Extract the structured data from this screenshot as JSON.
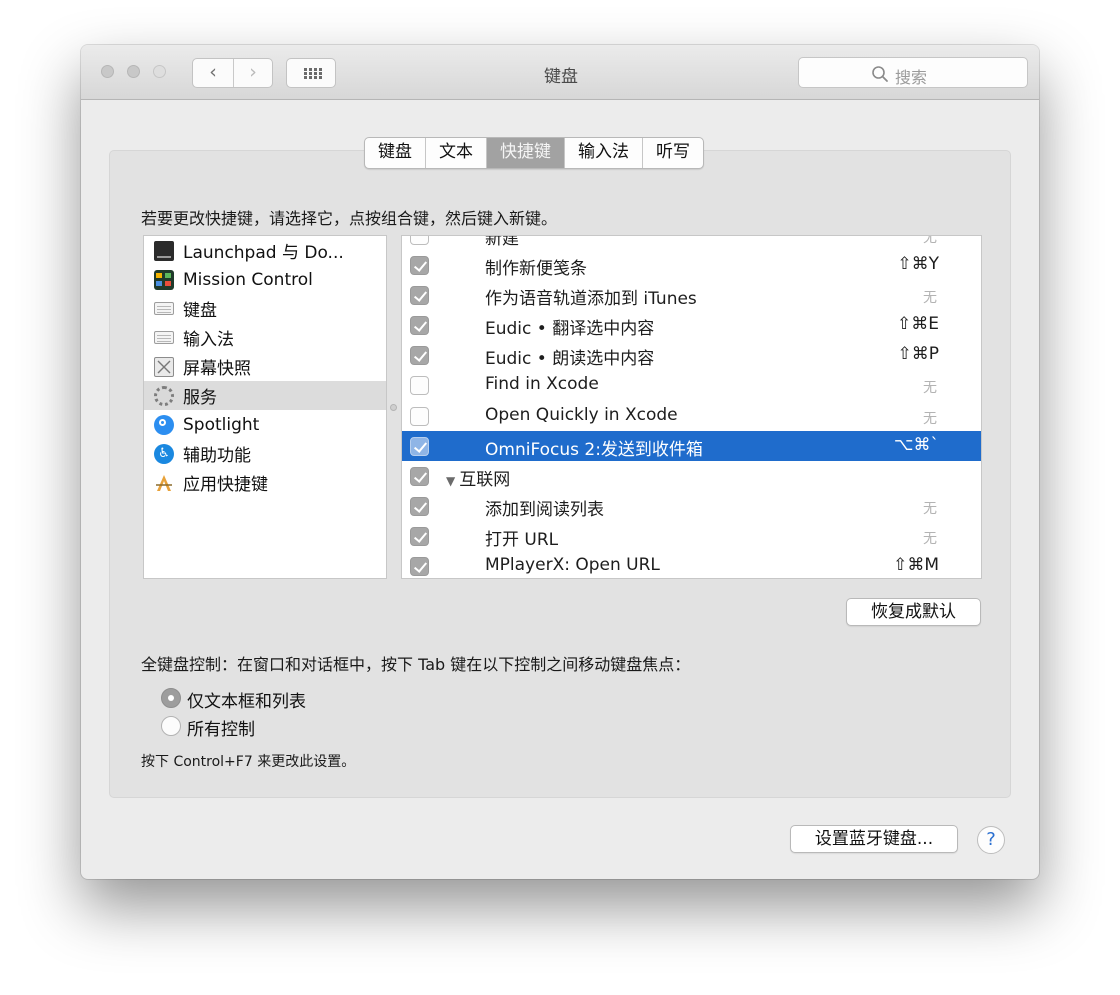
{
  "window": {
    "title": "键盘"
  },
  "toolbar": {
    "back_glyph": "‹",
    "forward_glyph": "›",
    "search_placeholder": "搜索"
  },
  "tabs": [
    {
      "label": "键盘",
      "active": false
    },
    {
      "label": "文本",
      "active": false
    },
    {
      "label": "快捷键",
      "active": true
    },
    {
      "label": "输入法",
      "active": false
    },
    {
      "label": "听写",
      "active": false
    }
  ],
  "instruction": "若要更改快捷键，请选择它，点按组合键，然后键入新键。",
  "categories": [
    {
      "label": "Launchpad 与 Do...",
      "icon": "launchpad-icon"
    },
    {
      "label": "Mission Control",
      "icon": "mission-control-icon"
    },
    {
      "label": "键盘",
      "icon": "keyboard-icon"
    },
    {
      "label": "输入法",
      "icon": "input-source-icon"
    },
    {
      "label": "屏幕快照",
      "icon": "screenshot-icon"
    },
    {
      "label": "服务",
      "icon": "gear-icon",
      "selected": true
    },
    {
      "label": "Spotlight",
      "icon": "spotlight-icon"
    },
    {
      "label": "辅助功能",
      "icon": "accessibility-icon"
    },
    {
      "label": "应用快捷键",
      "icon": "app-shortcuts-icon"
    }
  ],
  "shortcuts": [
    {
      "label": "新建",
      "checked": false,
      "key": "无"
    },
    {
      "label": "制作新便笺条",
      "checked": true,
      "key": "⇧⌘Y"
    },
    {
      "label": "作为语音轨道添加到 iTunes",
      "checked": true,
      "key": "无"
    },
    {
      "label": "Eudic • 翻译选中内容",
      "checked": true,
      "key": "⇧⌘E"
    },
    {
      "label": "Eudic • 朗读选中内容",
      "checked": true,
      "key": "⇧⌘P"
    },
    {
      "label": "Find in Xcode",
      "checked": false,
      "key": "无"
    },
    {
      "label": "Open Quickly in Xcode",
      "checked": false,
      "key": "无"
    },
    {
      "label": "OmniFocus 2:发送到收件箱",
      "checked": true,
      "key": "⌥⌘`",
      "selected": true
    },
    {
      "label": "互联网",
      "checked": true,
      "key": "",
      "group": true
    },
    {
      "label": "添加到阅读列表",
      "checked": true,
      "key": "无"
    },
    {
      "label": "打开 URL",
      "checked": true,
      "key": "无"
    },
    {
      "label": "MPlayerX: Open URL",
      "checked": true,
      "key": "⇧⌘M"
    }
  ],
  "restore_defaults": "恢复成默认",
  "full_keyboard_access": {
    "label": "全键盘控制：在窗口和对话框中，按下 Tab 键在以下控制之间移动键盘焦点：",
    "options": [
      {
        "label": "仅文本框和列表",
        "selected": true
      },
      {
        "label": "所有控制",
        "selected": false
      }
    ],
    "hint": "按下 Control+F7 来更改此设置。"
  },
  "bluetooth_button": "设置蓝牙键盘...",
  "help_glyph": "?",
  "colors": {
    "selection": "#1f6ccc",
    "checkbox_checked": "#a7a7a7",
    "help_accent": "#2a6fd1"
  }
}
